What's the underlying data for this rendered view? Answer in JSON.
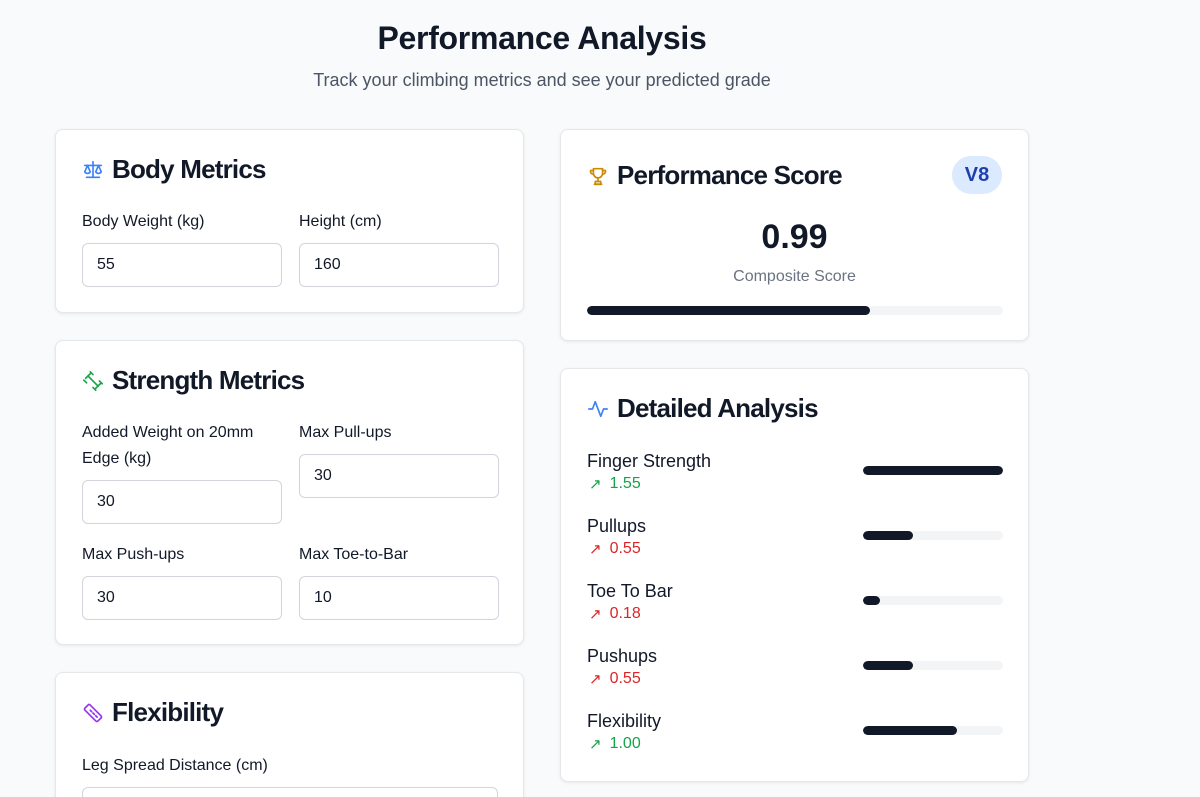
{
  "header": {
    "title": "Performance Analysis",
    "subtitle": "Track your climbing metrics and see your predicted grade"
  },
  "body_metrics": {
    "title": "Body Metrics",
    "icon": "scale-icon",
    "weight_label": "Body Weight (kg)",
    "weight_value": "55",
    "height_label": "Height (cm)",
    "height_value": "160"
  },
  "strength_metrics": {
    "title": "Strength Metrics",
    "icon": "dumbbell-icon",
    "edge_label_line1": "Added Weight on 20mm",
    "edge_label_line2": "Edge (kg)",
    "edge_value": "30",
    "pullups_label": "Max Pull-ups",
    "pullups_value": "30",
    "pushups_label": "Max Push-ups",
    "pushups_value": "30",
    "toetobar_label": "Max Toe-to-Bar",
    "toetobar_value": "10"
  },
  "flexibility": {
    "title": "Flexibility",
    "icon": "ruler-icon",
    "leg_spread_label": "Leg Spread Distance (cm)"
  },
  "performance_score": {
    "title": "Performance Score",
    "icon": "trophy-icon",
    "grade": "V8",
    "score": "0.99",
    "caption": "Composite Score",
    "progress": 0.68
  },
  "detailed_analysis": {
    "title": "Detailed Analysis",
    "icon": "activity-icon",
    "items": [
      {
        "name": "Finger Strength",
        "value": "1.55",
        "direction": "up",
        "level": 1.0
      },
      {
        "name": "Pullups",
        "value": "0.55",
        "direction": "down",
        "level": 0.36
      },
      {
        "name": "Toe To Bar",
        "value": "0.18",
        "direction": "down",
        "level": 0.12
      },
      {
        "name": "Pushups",
        "value": "0.55",
        "direction": "down",
        "level": 0.36
      },
      {
        "name": "Flexibility",
        "value": "1.00",
        "direction": "up",
        "level": 0.67
      }
    ]
  },
  "colors": {
    "bar_fill": "#111827",
    "bar_track": "#f3f4f6",
    "up": "#16a34a",
    "down": "#dc2626",
    "badge_bg": "#dbeafe",
    "badge_text": "#1e40af"
  }
}
